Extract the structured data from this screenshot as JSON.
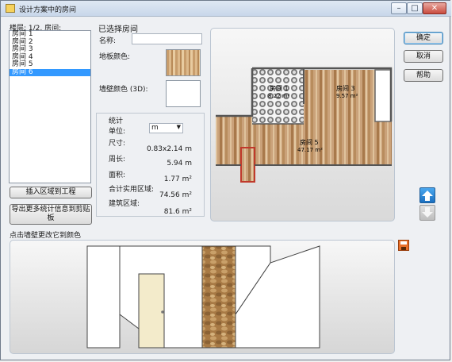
{
  "window": {
    "title": "设计方案中的房间"
  },
  "window_controls": {
    "minimize": "–",
    "maximize": "□",
    "close": "✕"
  },
  "left": {
    "floor_label": "楼层: 1/2, 房间:",
    "rooms": [
      {
        "label": "房间 1",
        "selected": false
      },
      {
        "label": "房间 2",
        "selected": false
      },
      {
        "label": "房间 3",
        "selected": false
      },
      {
        "label": "房间 4",
        "selected": false
      },
      {
        "label": "房间 5",
        "selected": false
      },
      {
        "label": "房间 6",
        "selected": true
      }
    ],
    "insert_button": "插入区域到工程",
    "export_button": "导出更多统计信息到剪贴板"
  },
  "details": {
    "section_title": "已选择房间",
    "name_label": "名称:",
    "name_value": "",
    "floor_color_label": "地板颜色:",
    "wall_color_label": "墙壁颜色 (3D):"
  },
  "stats": {
    "title": "统计",
    "unit_label": "单位:",
    "unit_value": "m",
    "size_label": "尺寸:",
    "size_value": "0.83x2.14 m",
    "perimeter_label": "周长:",
    "perimeter_value": "5.94 m",
    "area_label": "面积:",
    "area_value": "1.77 m²",
    "usable_label": "合计实用区域:",
    "usable_value": "74.56 m²",
    "built_label": "建筑区域:",
    "built_value": "81.6 m²"
  },
  "plan": {
    "room_left_name": "房间 1",
    "room_left_area": "8.22 m²",
    "room_right_name": "房间 3",
    "room_right_area": "9.57 m²",
    "room_main_name": "房间 5",
    "room_main_area": "47.17 m²"
  },
  "buttons": {
    "ok": "确定",
    "cancel": "取消",
    "help": "帮助"
  },
  "preview_label": "点击墙壁更改它到颜色",
  "icons": [
    "app-icon",
    "arrow-up-icon",
    "arrow-down-icon",
    "save-icon"
  ]
}
